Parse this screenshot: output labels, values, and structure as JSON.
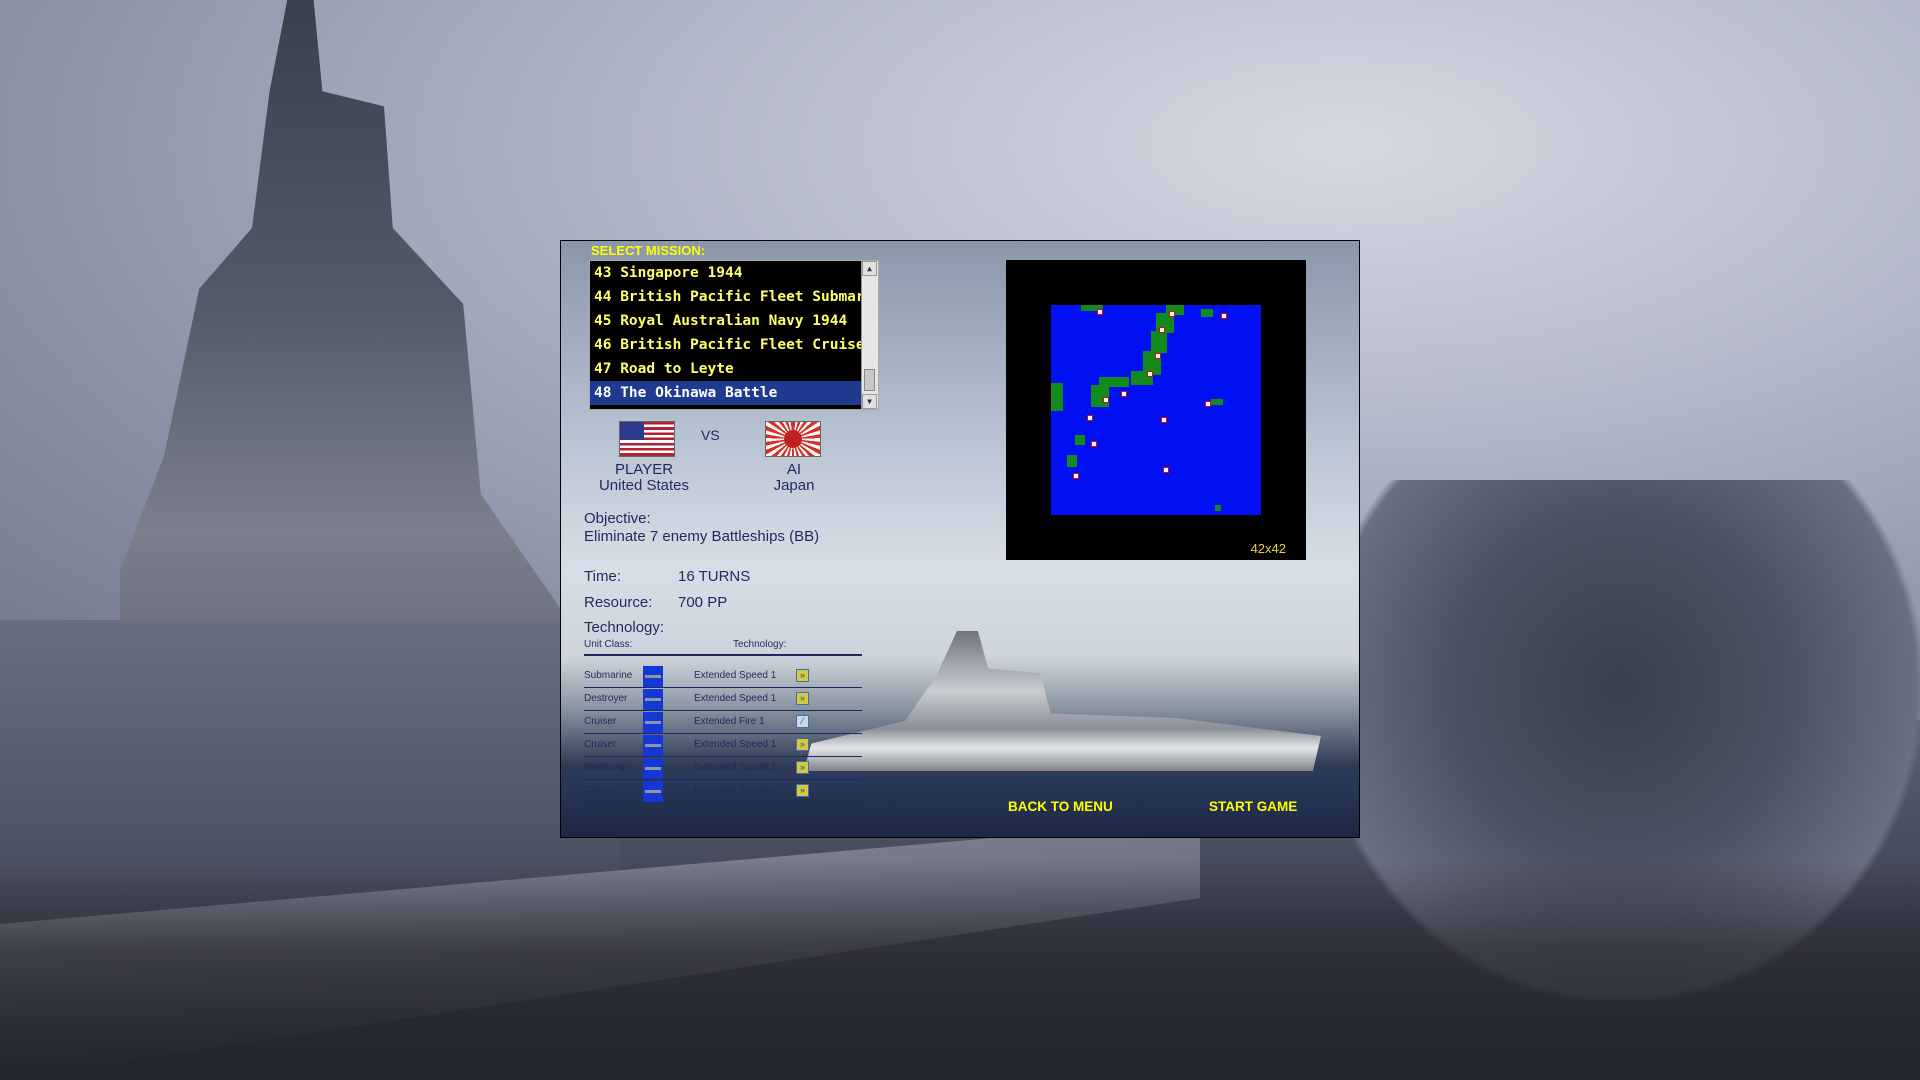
{
  "dialog": {
    "select_label": "SELECT MISSION:",
    "missions": [
      {
        "num": "43",
        "name": "Singapore 1944"
      },
      {
        "num": "44",
        "name": "British Pacific Fleet Submarines"
      },
      {
        "num": "45",
        "name": "Royal Australian Navy 1944"
      },
      {
        "num": "46",
        "name": "British Pacific Fleet Cruisers"
      },
      {
        "num": "47",
        "name": "Road to Leyte"
      },
      {
        "num": "48",
        "name": "The Okinawa Battle"
      }
    ],
    "selected_index": 5,
    "vs_label": "VS",
    "player": {
      "role": "PLAYER",
      "nation": "United States"
    },
    "opponent": {
      "role": "AI",
      "nation": "Japan"
    },
    "objective_label": "Objective:",
    "objective_text": "Eliminate 7 enemy Battleships (BB)",
    "time_label": "Time:",
    "time_value": "16 TURNS",
    "resource_label": "Resource:",
    "resource_value": "700 PP",
    "technology_label": "Technology:",
    "unit_class_header": "Unit Class:",
    "technology_header": "Technology:",
    "tech_rows": [
      {
        "unit": "Submarine",
        "tech": "Extended Speed 1",
        "icon": "speed-icon"
      },
      {
        "unit": "Destroyer",
        "tech": "Extended Speed 1",
        "icon": "speed-icon"
      },
      {
        "unit": "Cruiser",
        "tech": "Extended Fire 1",
        "icon": "fire-icon"
      },
      {
        "unit": "Cruiser",
        "tech": "Extended Speed 1",
        "icon": "speed-icon"
      },
      {
        "unit": "Battleship",
        "tech": "Extended Speed 1",
        "icon": "speed-icon"
      },
      {
        "unit": "Carrier",
        "tech": "Extended Speed 1",
        "icon": "speed-icon"
      }
    ],
    "map_size": "42x42",
    "back_button": "BACK TO MENU",
    "start_button": "START GAME"
  },
  "colors": {
    "accent_yellow": "#ffff00",
    "map_sea": "#0010f2",
    "map_land": "#128a1c",
    "selection": "#1f3a8f"
  }
}
